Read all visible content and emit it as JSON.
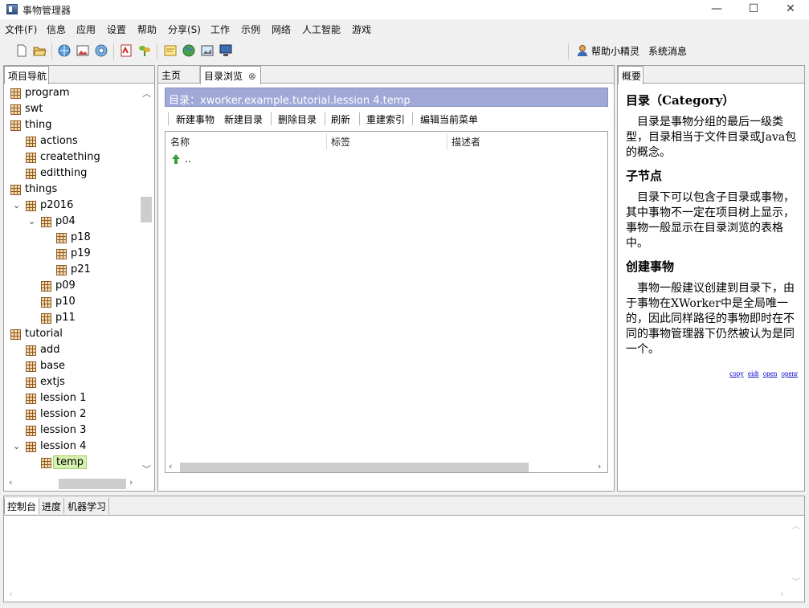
{
  "window": {
    "title": "事物管理器",
    "minimize": "—",
    "maximize": "☐",
    "close": "✕"
  },
  "menu": [
    "文件(F)",
    "信息",
    "应用",
    "设置",
    "帮助",
    "分享(S)",
    "工作",
    "示例",
    "网络",
    "人工智能",
    "游戏"
  ],
  "toolbar": {
    "helper": "帮助小精灵",
    "messages": "系统消息"
  },
  "left_panel": {
    "tab": "项目导航",
    "tree": [
      {
        "label": "program",
        "level": 0,
        "expand": ""
      },
      {
        "label": "swt",
        "level": 0,
        "expand": ""
      },
      {
        "label": "thing",
        "level": 0,
        "expand": ""
      },
      {
        "label": "actions",
        "level": 1,
        "expand": ""
      },
      {
        "label": "creatething",
        "level": 1,
        "expand": ""
      },
      {
        "label": "editthing",
        "level": 1,
        "expand": ""
      },
      {
        "label": "things",
        "level": 0,
        "expand": ""
      },
      {
        "label": "p2016",
        "level": 1,
        "expand": "open"
      },
      {
        "label": "p04",
        "level": 2,
        "expand": "open"
      },
      {
        "label": "p18",
        "level": 3,
        "expand": ""
      },
      {
        "label": "p19",
        "level": 3,
        "expand": ""
      },
      {
        "label": "p21",
        "level": 3,
        "expand": ""
      },
      {
        "label": "p09",
        "level": 2,
        "expand": ""
      },
      {
        "label": "p10",
        "level": 2,
        "expand": ""
      },
      {
        "label": "p11",
        "level": 2,
        "expand": ""
      },
      {
        "label": "tutorial",
        "level": 0,
        "expand": ""
      },
      {
        "label": "add",
        "level": 1,
        "expand": ""
      },
      {
        "label": "base",
        "level": 1,
        "expand": ""
      },
      {
        "label": "extjs",
        "level": 1,
        "expand": ""
      },
      {
        "label": "lession 1",
        "level": 1,
        "expand": ""
      },
      {
        "label": "lession 2",
        "level": 1,
        "expand": ""
      },
      {
        "label": "lession 3",
        "level": 1,
        "expand": ""
      },
      {
        "label": "lession 4",
        "level": 1,
        "expand": "open"
      },
      {
        "label": "temp",
        "level": 2,
        "expand": "",
        "selected": true
      }
    ]
  },
  "center_panel": {
    "tabs": [
      {
        "label": "主页"
      },
      {
        "label": "目录浏览",
        "close": "⊗"
      }
    ],
    "path": "目录：xworker.example.tutorial.lession 4.temp",
    "actions": [
      "新建事物",
      "新建目录",
      "删除目录",
      "刷新",
      "重建索引",
      "编辑当前菜单"
    ],
    "columns": [
      "名称",
      "标签",
      "描述者"
    ],
    "rows": [
      {
        "name": "..",
        "icon": "up-arrow-icon"
      }
    ]
  },
  "right_panel": {
    "tab": "概要",
    "heading1": "目录（Category）",
    "para1": "目录是事物分组的最后一级类型，目录相当于文件目录或Java包的概念。",
    "heading2": "子节点",
    "para2": "目录下可以包含子目录或事物，其中事物不一定在项目树上显示，事物一般显示在目录浏览的表格中。",
    "heading3": "创建事物",
    "para3": "事物一般建议创建到目录下，由于事物在XWorker中是全局唯一的，因此同样路径的事物即时在不同的事物管理器下仍然被认为是同一个。",
    "links": [
      "copy",
      "eidt",
      "open",
      "openr"
    ]
  },
  "bottom_panel": {
    "tabs": [
      "控制台",
      "进度",
      "机器学习"
    ]
  },
  "colors": {
    "path_bar": "#a0a8d8",
    "selected_row": "#d6f0b0",
    "link": "#0000cc"
  }
}
